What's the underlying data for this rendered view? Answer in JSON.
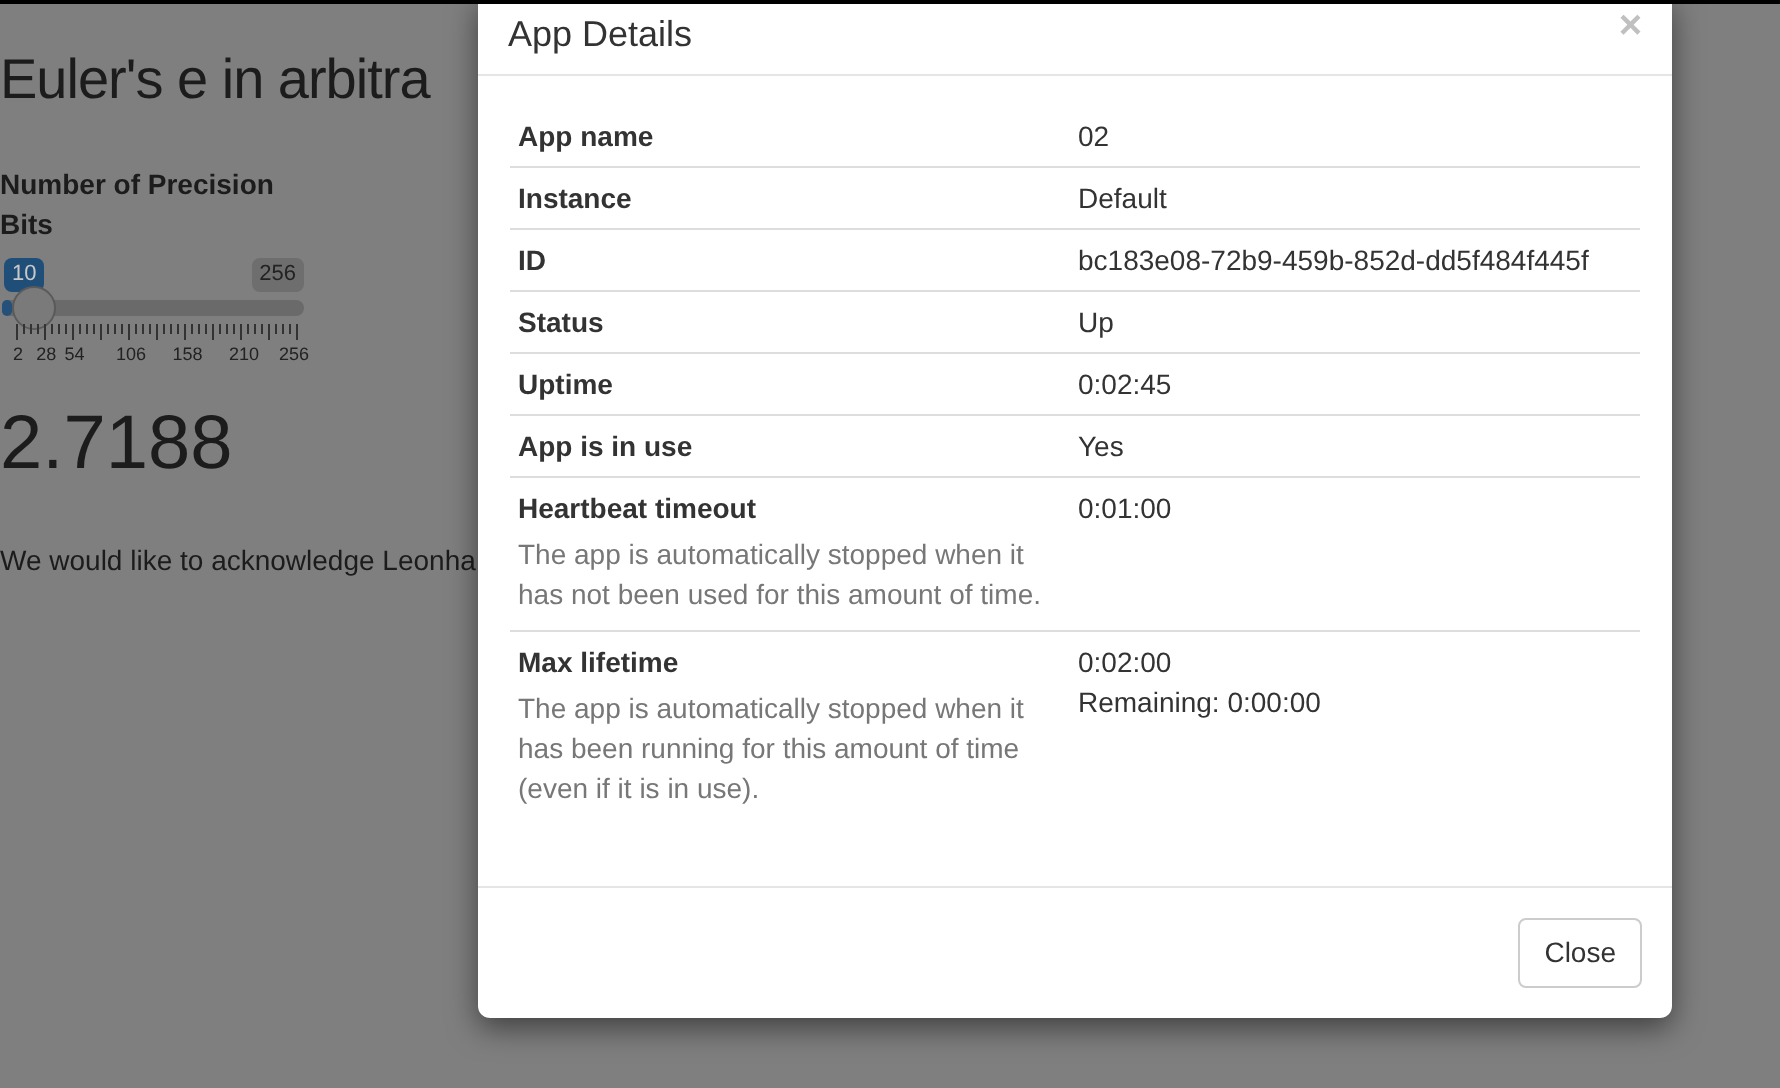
{
  "page": {
    "title": "Euler's e in arbitra",
    "slider": {
      "label": "Number of Precision Bits",
      "value": "10",
      "max": "256",
      "level": 0.031,
      "ticks": [
        "2",
        "28",
        "54",
        "106",
        "158",
        "210",
        "256"
      ]
    },
    "result": "2.7188",
    "text": "We would like to acknowledge Leonha"
  },
  "dialog": {
    "title": "App Details",
    "close": "×",
    "rows": [
      {
        "label": "App name",
        "value": "02"
      },
      {
        "label": "Instance",
        "value": "Default"
      },
      {
        "label": "ID",
        "value": "bc183e08-72b9-459b-852d-dd5f484f445f"
      },
      {
        "label": "Status",
        "value": "Up"
      },
      {
        "label": "Uptime",
        "value": "0:02:45"
      },
      {
        "label": "App is in use",
        "value": "Yes"
      },
      {
        "label": "Heartbeat timeout",
        "value": "0:01:00",
        "description": "The app is automatically stopped when it has not been used for this amount of time."
      },
      {
        "label": "Max lifetime",
        "value": "0:02:00",
        "extra": "Remaining: 0:00:00",
        "description": "The app is automatically stopped when it has been running for this amount of time (even if it is in use)."
      }
    ],
    "button": "Close"
  }
}
